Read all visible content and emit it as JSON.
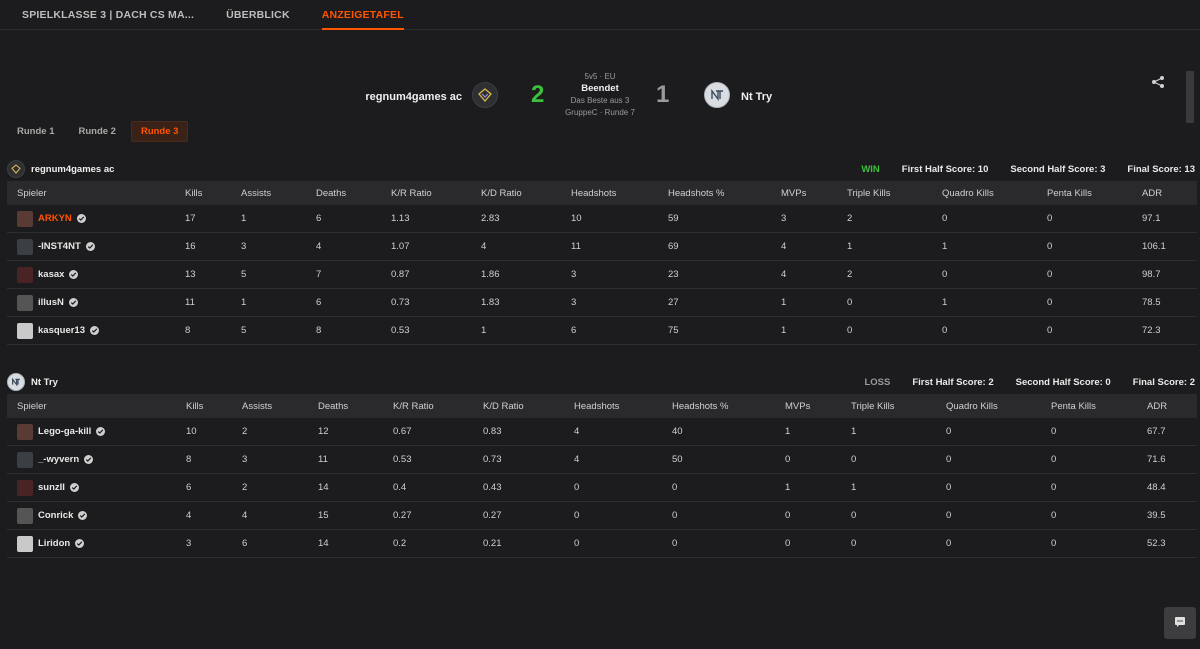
{
  "nav": {
    "tabs": [
      {
        "label": "SPIELKLASSE 3 | DACH CS MA..."
      },
      {
        "label": "ÜBERBLICK"
      },
      {
        "label": "ANZEIGETAFEL"
      }
    ],
    "active_tab": "ANZEIGETAFEL"
  },
  "match": {
    "team1": "regnum4games ac",
    "team2": "Nt Try",
    "score1": "2",
    "score2": "1",
    "format": "5v5 · EU",
    "status": "Beendet",
    "best_of": "Das Beste aus 3",
    "group": "GruppeC · Runde 7"
  },
  "rounds": {
    "items": [
      {
        "label": "Runde 1"
      },
      {
        "label": "Runde 2"
      },
      {
        "label": "Runde 3"
      }
    ],
    "active": "Runde 3"
  },
  "columns": [
    "Spieler",
    "Kills",
    "Assists",
    "Deaths",
    "K/R Ratio",
    "K/D Ratio",
    "Headshots",
    "Headshots %",
    "MVPs",
    "Triple Kills",
    "Quadro Kills",
    "Penta Kills",
    "ADR"
  ],
  "team1_stats": {
    "name": "regnum4games ac",
    "result": "WIN",
    "first_half": "First Half Score: 10",
    "second_half": "Second Half Score: 3",
    "final": "Final Score: 13",
    "players": [
      {
        "name": "ARKYN",
        "cells": [
          "17",
          "1",
          "6",
          "1.13",
          "2.83",
          "10",
          "59",
          "3",
          "2",
          "0",
          "0",
          "97.1"
        ]
      },
      {
        "name": "-INST4NT",
        "cells": [
          "16",
          "3",
          "4",
          "1.07",
          "4",
          "11",
          "69",
          "4",
          "1",
          "1",
          "0",
          "106.1"
        ]
      },
      {
        "name": "kasax",
        "cells": [
          "13",
          "5",
          "7",
          "0.87",
          "1.86",
          "3",
          "23",
          "4",
          "2",
          "0",
          "0",
          "98.7"
        ]
      },
      {
        "name": "illusN",
        "cells": [
          "11",
          "1",
          "6",
          "0.73",
          "1.83",
          "3",
          "27",
          "1",
          "0",
          "1",
          "0",
          "78.5"
        ]
      },
      {
        "name": "kasquer13",
        "cells": [
          "8",
          "5",
          "8",
          "0.53",
          "1",
          "6",
          "75",
          "1",
          "0",
          "0",
          "0",
          "72.3"
        ]
      }
    ]
  },
  "team2_stats": {
    "name": "Nt Try",
    "result": "LOSS",
    "first_half": "First Half Score: 2",
    "second_half": "Second Half Score: 0",
    "final": "Final Score: 2",
    "players": [
      {
        "name": "Lego-ga-kill",
        "cells": [
          "10",
          "2",
          "12",
          "0.67",
          "0.83",
          "4",
          "40",
          "1",
          "1",
          "0",
          "0",
          "67.7"
        ]
      },
      {
        "name": "_-wyvern",
        "cells": [
          "8",
          "3",
          "11",
          "0.53",
          "0.73",
          "4",
          "50",
          "0",
          "0",
          "0",
          "0",
          "71.6"
        ]
      },
      {
        "name": "sunzII",
        "cells": [
          "6",
          "2",
          "14",
          "0.4",
          "0.43",
          "0",
          "0",
          "1",
          "1",
          "0",
          "0",
          "48.4"
        ]
      },
      {
        "name": "Conrick",
        "cells": [
          "4",
          "4",
          "15",
          "0.27",
          "0.27",
          "0",
          "0",
          "0",
          "0",
          "0",
          "0",
          "39.5"
        ]
      },
      {
        "name": "Liridon",
        "cells": [
          "3",
          "6",
          "14",
          "0.2",
          "0.21",
          "0",
          "0",
          "0",
          "0",
          "0",
          "0",
          "52.3"
        ]
      }
    ]
  },
  "colors": {
    "accent": "#ff5500",
    "win": "#3cc13c",
    "background": "#1c1c1e"
  },
  "icons": [
    "share-icon",
    "chat-icon",
    "verified-icon",
    "team-logo-icon"
  ]
}
